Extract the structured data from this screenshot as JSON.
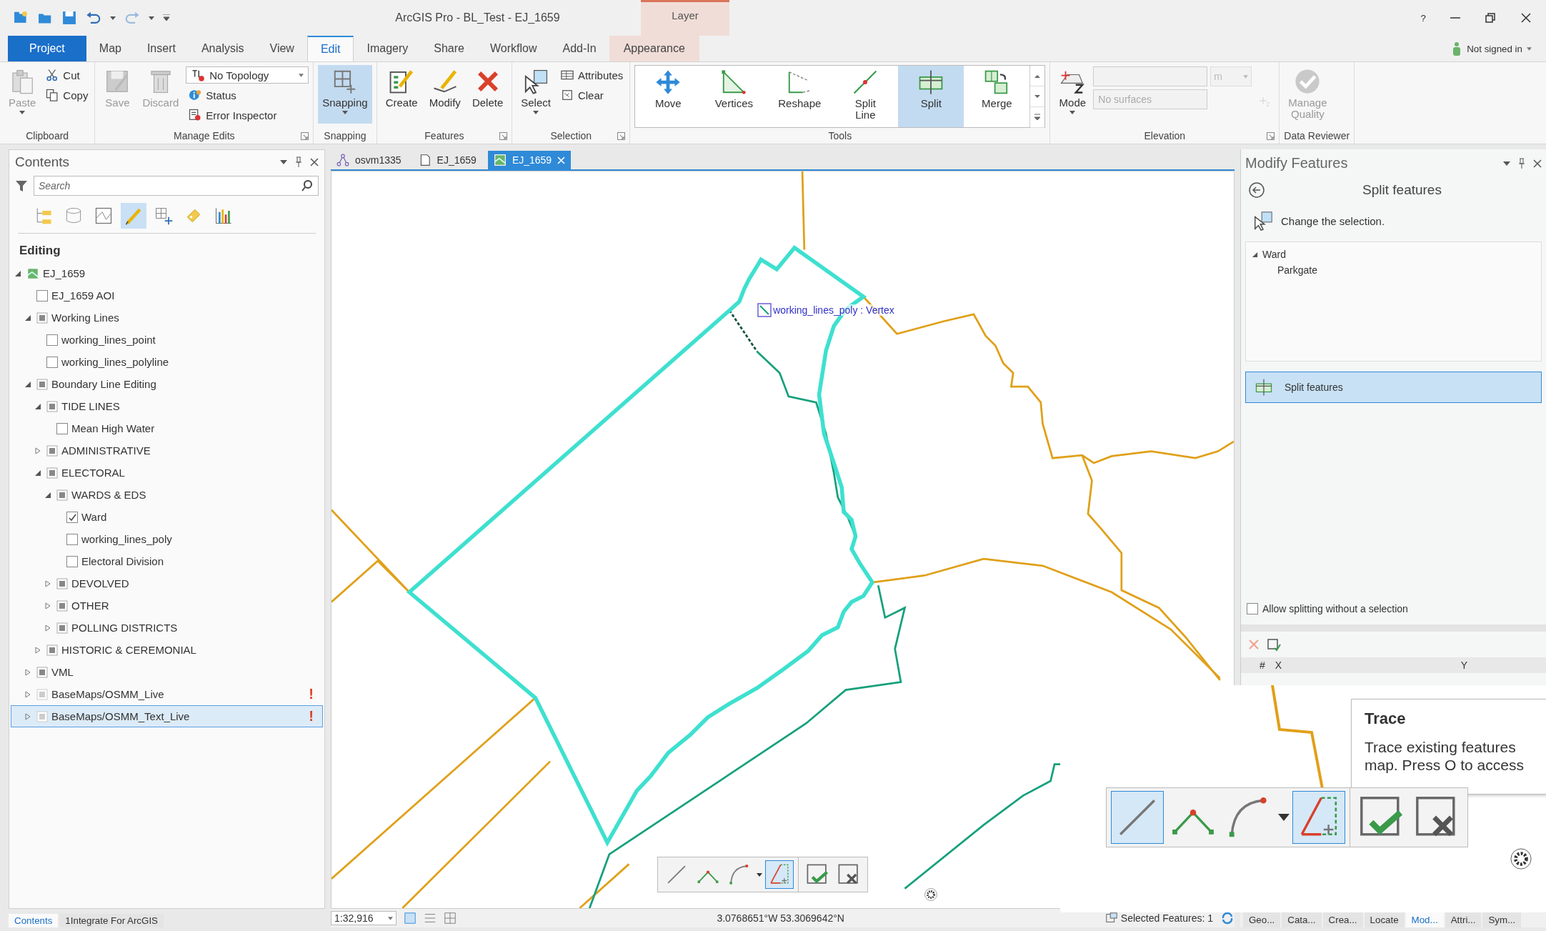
{
  "window": {
    "title": "ArcGIS Pro - BL_Test - EJ_1659",
    "help": "?",
    "contextual_group": "Layer"
  },
  "ribbon_tabs": [
    {
      "label": "Project",
      "kind": "backstage",
      "selected": false
    },
    {
      "label": "Map",
      "kind": "tab",
      "selected": false
    },
    {
      "label": "Insert",
      "kind": "tab",
      "selected": false
    },
    {
      "label": "Analysis",
      "kind": "tab",
      "selected": false
    },
    {
      "label": "View",
      "kind": "tab",
      "selected": false
    },
    {
      "label": "Edit",
      "kind": "tab",
      "selected": true
    },
    {
      "label": "Imagery",
      "kind": "tab",
      "selected": false
    },
    {
      "label": "Share",
      "kind": "tab",
      "selected": false
    },
    {
      "label": "Workflow",
      "kind": "tab",
      "selected": false
    },
    {
      "label": "Add-In",
      "kind": "tab",
      "selected": false
    },
    {
      "label": "Appearance",
      "kind": "contextual",
      "selected": false
    }
  ],
  "account": "Not signed in",
  "ribbon_groups": [
    {
      "title": "Clipboard",
      "kind": "standard",
      "launcher": false,
      "items": [
        {
          "kind": "large",
          "label": "Paste",
          "disabled": true,
          "menu": true,
          "selected": false
        },
        {
          "kind": "small",
          "label": "Cut",
          "disabled": false
        },
        {
          "kind": "small",
          "label": "Copy",
          "disabled": false
        }
      ]
    },
    {
      "title": "Manage Edits",
      "kind": "standard",
      "launcher": true,
      "items": [
        {
          "kind": "large",
          "label": "Save",
          "disabled": true,
          "menu": false,
          "selected": false
        },
        {
          "kind": "large",
          "label": "Discard",
          "disabled": true,
          "menu": false,
          "selected": false
        },
        {
          "kind": "dropdown",
          "label": "No Topology",
          "disabled": false
        },
        {
          "kind": "small",
          "label": "Status",
          "disabled": false
        },
        {
          "kind": "small",
          "label": "Error Inspector",
          "disabled": false
        }
      ]
    },
    {
      "title": "Snapping",
      "kind": "standard",
      "launcher": false,
      "items": [
        {
          "kind": "large",
          "label": "Snapping",
          "disabled": false,
          "menu": true,
          "selected": true
        }
      ]
    },
    {
      "title": "Features",
      "kind": "standard",
      "launcher": true,
      "items": [
        {
          "kind": "large",
          "label": "Create",
          "disabled": false,
          "menu": false,
          "selected": false
        },
        {
          "kind": "large",
          "label": "Modify",
          "disabled": false,
          "menu": false,
          "selected": false
        },
        {
          "kind": "large",
          "label": "Delete",
          "disabled": false,
          "menu": false,
          "selected": false
        }
      ]
    },
    {
      "title": "Selection",
      "kind": "standard",
      "launcher": true,
      "items": [
        {
          "kind": "large",
          "label": "Select",
          "disabled": false,
          "menu": true,
          "selected": false
        },
        {
          "kind": "small",
          "label": "Attributes",
          "disabled": false
        },
        {
          "kind": "small",
          "label": "Clear",
          "disabled": false
        }
      ]
    },
    {
      "title": "Tools",
      "kind": "gallery",
      "launcher": false,
      "items": [
        {
          "kind": "large",
          "label": "Move",
          "disabled": false,
          "menu": false,
          "selected": false
        },
        {
          "kind": "large",
          "label": "Vertices",
          "disabled": false,
          "menu": false,
          "selected": false
        },
        {
          "kind": "large",
          "label": "Reshape",
          "disabled": false,
          "menu": false,
          "selected": false
        },
        {
          "kind": "large",
          "label": "Split Line",
          "disabled": false,
          "menu": false,
          "selected": false
        },
        {
          "kind": "large",
          "label": "Split",
          "disabled": false,
          "menu": false,
          "selected": true
        },
        {
          "kind": "large",
          "label": "Merge",
          "disabled": false,
          "menu": false,
          "selected": false
        }
      ]
    },
    {
      "title": "Elevation",
      "kind": "standard",
      "launcher": true,
      "items": [
        {
          "kind": "large",
          "label": "Mode",
          "disabled": false,
          "menu": true,
          "selected": false
        },
        {
          "kind": "field",
          "unit": "m",
          "disabled": true
        },
        {
          "kind": "field",
          "placeholder": "No surfaces",
          "disabled": true
        },
        {
          "kind": "icon_button",
          "disabled": true
        }
      ]
    },
    {
      "title": "Data Reviewer",
      "kind": "standard",
      "launcher": false,
      "items": [
        {
          "kind": "large",
          "label": "Manage Quality",
          "disabled": true,
          "menu": false,
          "selected": false
        }
      ]
    }
  ],
  "contents": {
    "title": "Contents",
    "search": {
      "placeholder": "Search"
    },
    "views": [
      {
        "selected": false
      },
      {
        "selected": false
      },
      {
        "selected": false
      },
      {
        "selected": true
      },
      {
        "selected": false
      },
      {
        "selected": false
      },
      {
        "selected": false
      }
    ],
    "heading": "Editing",
    "tree": [
      {
        "label": "EJ_1659",
        "kind": "map",
        "expanded": true,
        "selected": false,
        "children": [
          {
            "label": "EJ_1659 AOI",
            "kind": "layer",
            "checked": false,
            "selected": false
          },
          {
            "label": "Working Lines",
            "kind": "group",
            "expanded": true,
            "selected": false,
            "children": [
              {
                "label": "working_lines_point",
                "kind": "layer",
                "checked": false,
                "selected": false
              },
              {
                "label": "working_lines_polyline",
                "kind": "layer",
                "checked": false,
                "selected": false
              }
            ]
          },
          {
            "label": "Boundary Line Editing",
            "kind": "group",
            "expanded": true,
            "selected": false,
            "children": [
              {
                "label": "TIDE LINES",
                "kind": "group",
                "expanded": true,
                "selected": false,
                "children": [
                  {
                    "label": "Mean High Water",
                    "kind": "layer",
                    "checked": false,
                    "selected": false
                  }
                ]
              },
              {
                "label": "ADMINISTRATIVE",
                "kind": "group",
                "expanded": false,
                "selected": false
              },
              {
                "label": "ELECTORAL",
                "kind": "group",
                "expanded": true,
                "selected": false,
                "children": [
                  {
                    "label": "WARDS & EDS",
                    "kind": "group",
                    "expanded": true,
                    "selected": false,
                    "children": [
                      {
                        "label": "Ward",
                        "kind": "layer",
                        "checked": true,
                        "selected": false
                      },
                      {
                        "label": "working_lines_poly",
                        "kind": "layer",
                        "checked": false,
                        "selected": false
                      },
                      {
                        "label": "Electoral Division",
                        "kind": "layer",
                        "checked": false,
                        "selected": false
                      }
                    ]
                  },
                  {
                    "label": "DEVOLVED",
                    "kind": "group",
                    "expanded": false,
                    "selected": false
                  },
                  {
                    "label": "OTHER",
                    "kind": "group",
                    "expanded": false,
                    "selected": false
                  },
                  {
                    "label": "POLLING DISTRICTS",
                    "kind": "group",
                    "expanded": false,
                    "selected": false
                  }
                ]
              },
              {
                "label": "HISTORIC & CEREMONIAL",
                "kind": "group",
                "expanded": false,
                "selected": false
              }
            ]
          },
          {
            "label": "VML",
            "kind": "group",
            "expanded": false,
            "selected": false
          },
          {
            "label": "BaseMaps/OSMM_Live",
            "kind": "basemap",
            "expanded": false,
            "selected": false,
            "warning": "!"
          },
          {
            "label": "BaseMaps/OSMM_Text_Live",
            "kind": "basemap",
            "expanded": false,
            "selected": true,
            "warning": "!"
          }
        ]
      }
    ],
    "bottom_tabs": [
      {
        "label": "Contents",
        "selected": true
      },
      {
        "label": "1Integrate For ArcGIS",
        "selected": false
      }
    ]
  },
  "map_tabs": [
    {
      "label": "osvm1335",
      "kind": "diagram",
      "selected": false
    },
    {
      "label": "EJ_1659",
      "kind": "layout",
      "selected": false
    },
    {
      "label": "EJ_1659",
      "kind": "map",
      "selected": true
    }
  ],
  "map": {
    "snap_tip": "working_lines_poly : Vertex"
  },
  "sketch_toolbar": {
    "tools": [
      {
        "kind": "line",
        "selected": false
      },
      {
        "kind": "polyline",
        "selected": false
      },
      {
        "kind": "arc",
        "selected": false
      },
      {
        "kind": "trace",
        "selected": true
      }
    ],
    "actions": [
      {
        "kind": "finish"
      },
      {
        "kind": "cancel"
      }
    ]
  },
  "status_bar": {
    "scale": "1:32,916",
    "coordinates": "3.0768651°W 53.3069642°N",
    "selected_features": "Selected Features: 1"
  },
  "modify_features": {
    "title": "Modify Features",
    "tool_title": "Split features",
    "change_selection": "Change the selection.",
    "selection_tree": [
      {
        "label": "Ward",
        "expanded": true,
        "children": [
          {
            "label": "Parkgate"
          }
        ]
      }
    ],
    "tools": [
      {
        "label": "Split features",
        "selected": true
      }
    ],
    "option": {
      "label": "Allow splitting without a selection",
      "checked": false
    },
    "table_columns": [
      "#",
      "X",
      "Y"
    ]
  },
  "dock_tabs": [
    {
      "label": "Geo...",
      "selected": false
    },
    {
      "label": "Cata...",
      "selected": false
    },
    {
      "label": "Crea...",
      "selected": false
    },
    {
      "label": "Locate",
      "selected": false
    },
    {
      "label": "Mod...",
      "selected": true
    },
    {
      "label": "Attri...",
      "selected": false
    },
    {
      "label": "Sym...",
      "selected": false
    }
  ],
  "zoomed_toolbar": {
    "tools": [
      {
        "kind": "line",
        "selected": true
      },
      {
        "kind": "polyline",
        "selected": false
      },
      {
        "kind": "arc",
        "selected": false
      },
      {
        "kind": "trace",
        "selected": true
      }
    ],
    "actions": [
      {
        "kind": "finish"
      },
      {
        "kind": "cancel"
      }
    ]
  },
  "tooltip": {
    "title": "Trace",
    "lines": [
      "Trace existing features",
      "map. Press O to access"
    ]
  }
}
